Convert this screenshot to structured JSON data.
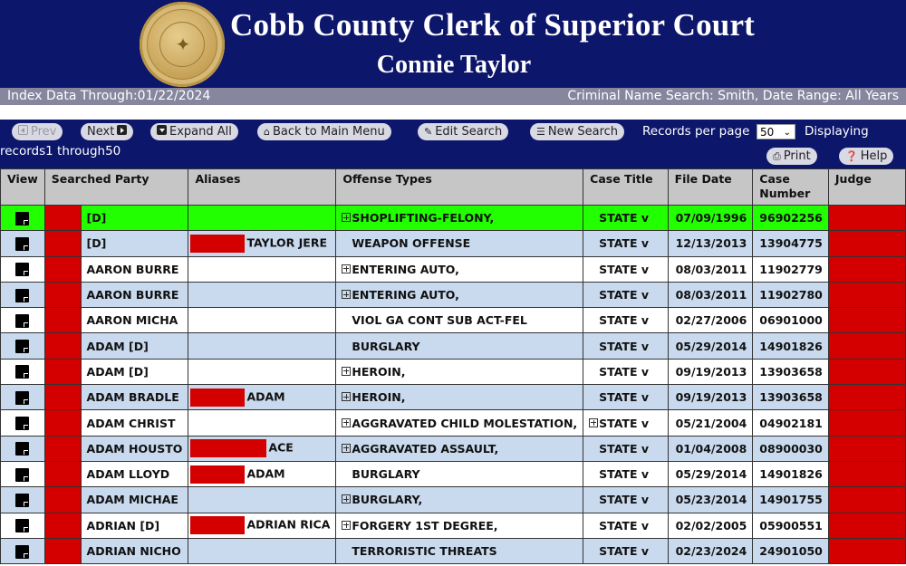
{
  "header": {
    "title": "Cobb County Clerk of Superior Court",
    "subtitle": "Connie Taylor",
    "seal_icon": "county-seal"
  },
  "infobar": {
    "index_date": "Index Data Through:01/22/2024",
    "search_summary": "Criminal Name Search: Smith, Date Range: All Years"
  },
  "toolbar": {
    "prev_label": "Prev",
    "next_label": "Next",
    "expand_all_label": "Expand All",
    "back_label": "Back to Main Menu",
    "edit_search_label": "Edit Search",
    "new_search_label": "New Search",
    "records_per_page_label": "Records per page",
    "records_per_page_value": "50",
    "displaying_label": "Displaying",
    "records_range": "records1 through50",
    "print_label": "Print",
    "help_label": "Help"
  },
  "table": {
    "headers": [
      "View",
      "Searched Party",
      "Aliases",
      "Offense Types",
      "Case Title",
      "File Date",
      "Case Number",
      "Judge"
    ],
    "rows": [
      {
        "party": "[D]",
        "alias_redacted": 0,
        "alias": "",
        "offense_expand": true,
        "offense": "SHOPLIFTING-FELONY,",
        "title_expand": false,
        "title": "STATE v",
        "date": "07/09/1996",
        "case": "96902256",
        "style": "green"
      },
      {
        "party": "[D]",
        "alias_redacted": 1,
        "alias": "TAYLOR JERE",
        "offense_expand": false,
        "offense": "WEAPON OFFENSE",
        "title_expand": false,
        "title": "STATE v",
        "date": "12/13/2013",
        "case": "13904775",
        "style": "blue"
      },
      {
        "party": "AARON BURRE",
        "alias_redacted": 0,
        "alias": "",
        "offense_expand": true,
        "offense": "ENTERING AUTO,",
        "title_expand": false,
        "title": "STATE v",
        "date": "08/03/2011",
        "case": "11902779",
        "style": "white"
      },
      {
        "party": "AARON BURRE",
        "alias_redacted": 0,
        "alias": "",
        "offense_expand": true,
        "offense": "ENTERING AUTO,",
        "title_expand": false,
        "title": "STATE v",
        "date": "08/03/2011",
        "case": "11902780",
        "style": "blue"
      },
      {
        "party": "AARON MICHA",
        "alias_redacted": 0,
        "alias": "",
        "offense_expand": false,
        "offense": "VIOL GA CONT SUB ACT-FEL",
        "title_expand": false,
        "title": "STATE v",
        "date": "02/27/2006",
        "case": "06901000",
        "style": "white"
      },
      {
        "party": "ADAM  [D]",
        "alias_redacted": 0,
        "alias": "",
        "offense_expand": false,
        "offense": "BURGLARY",
        "title_expand": false,
        "title": "STATE v",
        "date": "05/29/2014",
        "case": "14901826",
        "style": "blue"
      },
      {
        "party": "ADAM  [D]",
        "alias_redacted": 0,
        "alias": "",
        "offense_expand": true,
        "offense": "HEROIN,",
        "title_expand": false,
        "title": "STATE v",
        "date": "09/19/2013",
        "case": "13903658",
        "style": "white"
      },
      {
        "party": "ADAM BRADLE",
        "alias_redacted": 1,
        "alias": "ADAM",
        "offense_expand": true,
        "offense": "HEROIN,",
        "title_expand": false,
        "title": "STATE v",
        "date": "09/19/2013",
        "case": "13903658",
        "style": "blue"
      },
      {
        "party": "ADAM CHRIST",
        "alias_redacted": 0,
        "alias": "",
        "offense_expand": true,
        "offense": "AGGRAVATED CHILD MOLESTATION,",
        "title_expand": true,
        "title": "STATE v",
        "date": "05/21/2004",
        "case": "04902181",
        "style": "white"
      },
      {
        "party": "ADAM HOUSTO",
        "alias_redacted": 2,
        "alias": "ACE",
        "offense_expand": true,
        "offense": "AGGRAVATED ASSAULT,",
        "title_expand": false,
        "title": "STATE v",
        "date": "01/04/2008",
        "case": "08900030",
        "style": "blue"
      },
      {
        "party": "ADAM LLOYD",
        "alias_redacted": 1,
        "alias": "ADAM",
        "offense_expand": false,
        "offense": "BURGLARY",
        "title_expand": false,
        "title": "STATE v",
        "date": "05/29/2014",
        "case": "14901826",
        "style": "white"
      },
      {
        "party": "ADAM MICHAE",
        "alias_redacted": 0,
        "alias": "",
        "offense_expand": true,
        "offense": "BURGLARY,",
        "title_expand": false,
        "title": "STATE v",
        "date": "05/23/2014",
        "case": "14901755",
        "style": "blue"
      },
      {
        "party": "ADRIAN  [D]",
        "alias_redacted": 1,
        "alias": "ADRIAN RICA",
        "offense_expand": true,
        "offense": "FORGERY 1ST DEGREE,",
        "title_expand": false,
        "title": "STATE v",
        "date": "02/02/2005",
        "case": "05900551",
        "style": "white"
      },
      {
        "party": "ADRIAN NICHO",
        "alias_redacted": 0,
        "alias": "",
        "offense_expand": false,
        "offense": "TERRORISTIC THREATS",
        "title_expand": false,
        "title": "STATE v",
        "date": "02/23/2024",
        "case": "24901050",
        "style": "blue"
      }
    ]
  },
  "colors": {
    "header_bg": "#0c166a",
    "infobar_bg": "#86869e",
    "row_highlight": "#22ff00",
    "row_alt": "#c9daee",
    "redaction": "#d40000"
  }
}
